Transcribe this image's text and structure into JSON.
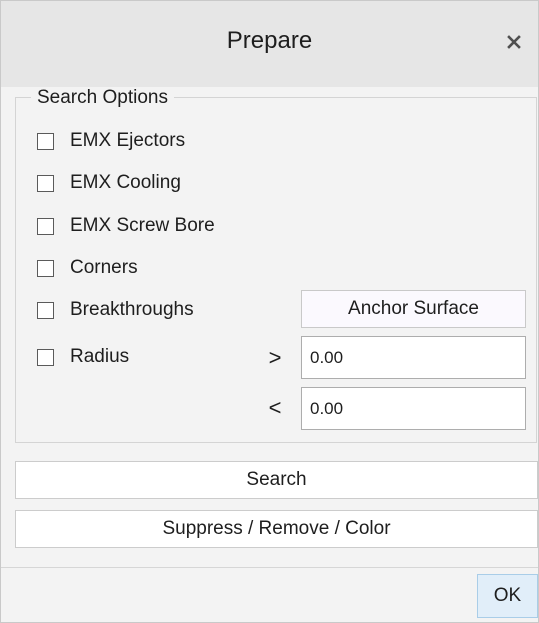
{
  "dialog": {
    "title": "Prepare",
    "close_glyph": "✕",
    "close_icon": "close-icon"
  },
  "search_options": {
    "legend": "Search Options",
    "options": [
      {
        "label": "EMX Ejectors",
        "checked": false
      },
      {
        "label": "EMX Cooling",
        "checked": false
      },
      {
        "label": "EMX Screw Bore",
        "checked": false
      },
      {
        "label": "Corners",
        "checked": false
      },
      {
        "label": "Breakthroughs",
        "checked": false
      },
      {
        "label": "Radius",
        "checked": false
      }
    ],
    "anchor_surface_label": "Anchor Surface",
    "radius_min": {
      "operator": ">",
      "value": "0.00"
    },
    "radius_max": {
      "operator": "<",
      "value": "0.00"
    }
  },
  "actions": {
    "search_label": "Search",
    "suppress_label": "Suppress / Remove / Color",
    "ok_label": "OK"
  }
}
